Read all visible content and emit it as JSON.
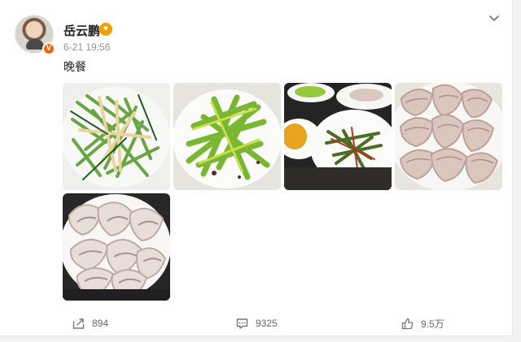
{
  "post": {
    "author": "岳云鹏",
    "time": "6-21 19:56",
    "text": "晚餐",
    "verified_mark": "V",
    "images": [
      {
        "description_icon": "cucumber-shredded-photo"
      },
      {
        "description_icon": "stir-fried-greens-photo"
      },
      {
        "description_icon": "dinner-table-photo"
      },
      {
        "description_icon": "dumplings-photo"
      },
      {
        "description_icon": "dumplings-plate-photo"
      }
    ]
  },
  "actions": {
    "share_count": "894",
    "comment_count": "9325",
    "like_count": "9.5万"
  },
  "colors": {
    "background": "#f2f2f2",
    "card": "#ffffff",
    "accent": "#f6620b",
    "text": "#222222",
    "muted": "#939393"
  }
}
